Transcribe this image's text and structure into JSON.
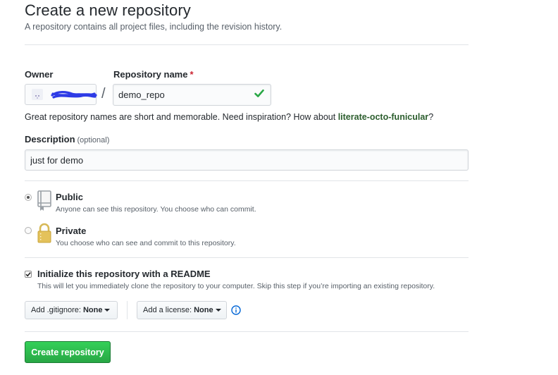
{
  "header": {
    "title": "Create a new repository",
    "subtitle": "A repository contains all project files, including the revision history."
  },
  "owner": {
    "label": "Owner"
  },
  "repo_name": {
    "label": "Repository name",
    "required_mark": "*",
    "value": "demo_repo",
    "separator": "/",
    "valid_icon": "check-icon"
  },
  "hint": {
    "text": "Great repository names are short and memorable. Need inspiration? How about",
    "suggestion": "literate-octo-funicular",
    "suffix": "?"
  },
  "description": {
    "label": "Description",
    "optional": "(optional)",
    "value": "just for demo"
  },
  "visibility": {
    "public": {
      "title": "Public",
      "desc": "Anyone can see this repository. You choose who can commit.",
      "selected": true,
      "icon": "repo-book-icon"
    },
    "private": {
      "title": "Private",
      "desc": "You choose who can see and commit to this repository.",
      "selected": false,
      "icon": "lock-icon"
    }
  },
  "readme": {
    "title": "Initialize this repository with a README",
    "desc": "This will let you immediately clone the repository to your computer. Skip this step if you’re importing an existing repository.",
    "checked": true
  },
  "gitignore": {
    "label": "Add .gitignore:",
    "value": "None"
  },
  "license": {
    "label": "Add a license:",
    "value": "None",
    "info_icon": "info-icon"
  },
  "submit": {
    "label": "Create repository"
  },
  "colors": {
    "accent_green": "#28a745",
    "link_green": "#2c5e2e",
    "required_red": "#cb2431",
    "info_blue": "#0366d6"
  }
}
